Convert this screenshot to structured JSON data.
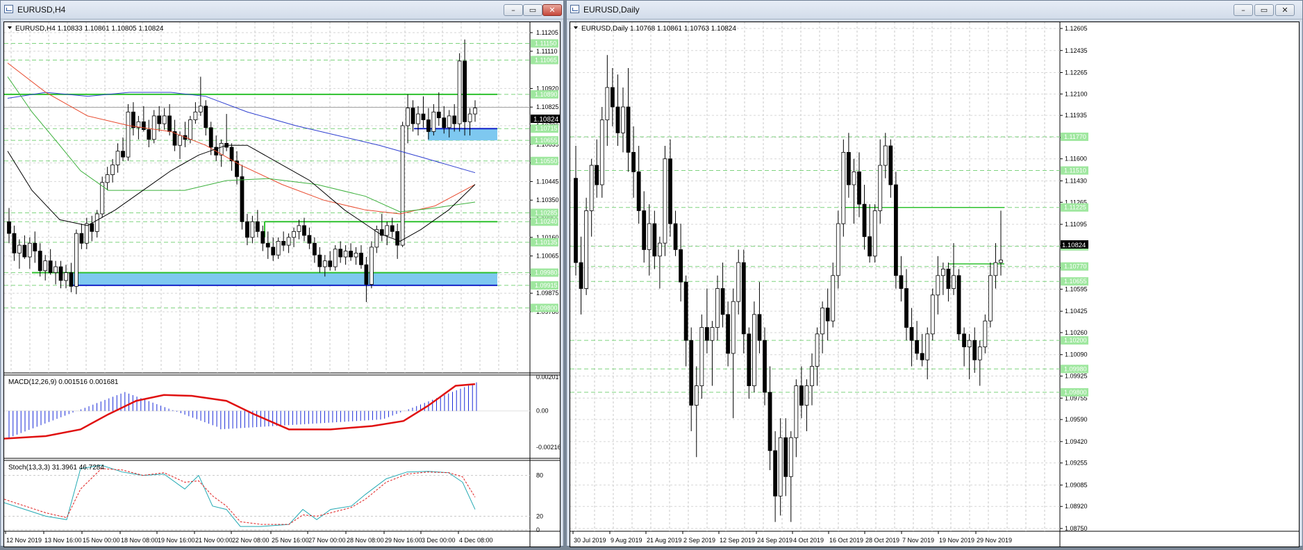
{
  "left": {
    "window_title": "EURUSD,H4",
    "header": "EURUSD,H4  1.10833 1.10861 1.10805 1.10824",
    "price_labels": [
      "1.11205",
      "1.11110",
      "1.10920",
      "1.10825",
      "1.10730",
      "1.10635",
      "1.10540",
      "1.10445",
      "1.10350",
      "1.10255",
      "1.10160",
      "1.10065",
      "1.09970",
      "1.09875",
      "1.09780"
    ],
    "green_labels": [
      "1.11150",
      "1.11065",
      "1.10890",
      "1.10715",
      "1.10655",
      "1.10550",
      "1.10285",
      "1.10240",
      "1.10135",
      "1.09980",
      "1.09915",
      "1.09800"
    ],
    "current_price": "1.10824",
    "macd_label": "MACD(12,26,9) 0.001516 0.001681",
    "macd_scale": [
      "0.002017",
      "0.00",
      "-0.002163"
    ],
    "stoch_label": "Stoch(13,3,3) 31.3961 46.7284",
    "stoch_scale": [
      "80",
      "20",
      "0"
    ],
    "dates": [
      "12 Nov 2019",
      "13 Nov 16:00",
      "15 Nov 00:00",
      "18 Nov 08:00",
      "19 Nov 16:00",
      "21 Nov 00:00",
      "22 Nov 08:00",
      "25 Nov 16:00",
      "27 Nov 00:00",
      "28 Nov 08:00",
      "29 Nov 16:00",
      "3 Dec 00:00",
      "4 Dec 08:00"
    ]
  },
  "right": {
    "window_title": "EURUSD,Daily",
    "header": "EURUSD,Daily  1.10768 1.10861 1.10763 1.10824",
    "price_labels": [
      "1.12605",
      "1.12435",
      "1.12265",
      "1.12100",
      "1.11935",
      "1.11765",
      "1.11600",
      "1.11430",
      "1.11265",
      "1.11095",
      "1.10930",
      "1.10760",
      "1.10595",
      "1.10425",
      "1.10260",
      "1.10090",
      "1.09925",
      "1.09755",
      "1.09590",
      "1.09420",
      "1.09255",
      "1.09085",
      "1.08920",
      "1.08750"
    ],
    "green_labels": [
      "1.11770",
      "1.11510",
      "1.11225",
      "1.10925",
      "1.10770",
      "1.10655",
      "1.10200",
      "1.09980",
      "1.09800"
    ],
    "current_price": "1.10824",
    "dates": [
      "30 Jul 2019",
      "9 Aug 2019",
      "21 Aug 2019",
      "2 Sep 2019",
      "12 Sep 2019",
      "24 Sep 2019",
      "4 Oct 2019",
      "16 Oct 2019",
      "28 Oct 2019",
      "7 Nov 2019",
      "19 Nov 2019",
      "29 Nov 2019"
    ]
  }
}
